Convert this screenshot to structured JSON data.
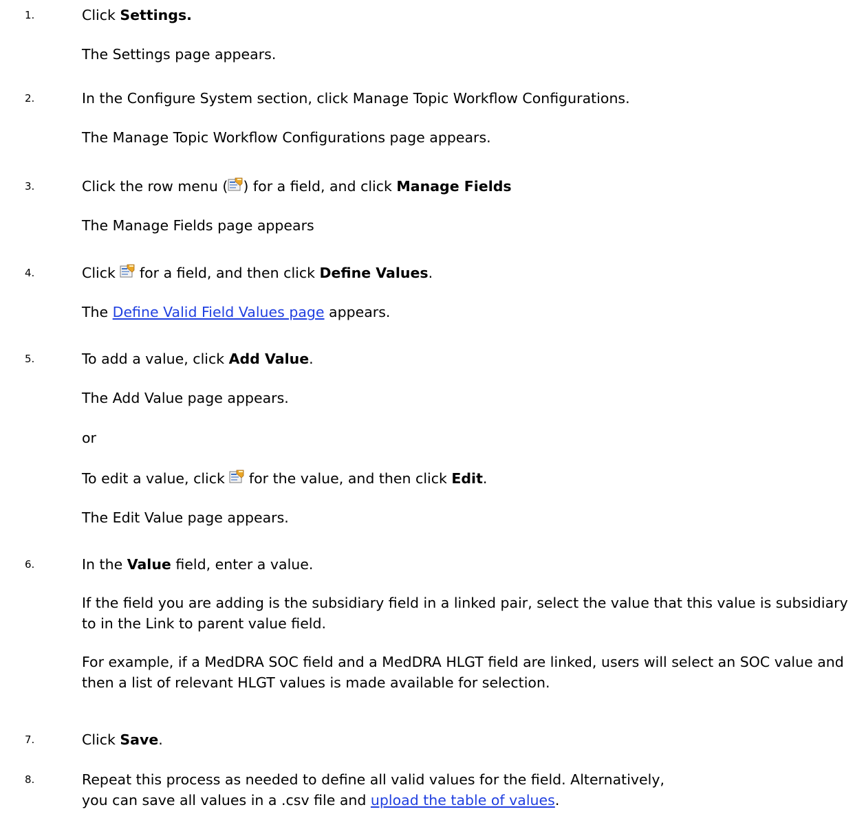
{
  "steps": {
    "s1": {
      "num": "1.",
      "pre": "Click ",
      "bold": "Settings.",
      "result": "The Settings page appears."
    },
    "s2": {
      "num": "2.",
      "text": "In the Configure System section, click Manage Topic Workflow Configurations.",
      "result": "The Manage Topic Workflow Configurations page appears."
    },
    "s3": {
      "num": "3.",
      "pre": "Click the row menu (",
      "mid": ") for a field, and click ",
      "bold": "Manage Fields",
      "result": "The Manage Fields page appears"
    },
    "s4": {
      "num": "4.",
      "pre": "Click ",
      "mid": " for a field, and then click ",
      "bold": "Define Values",
      "post": ".",
      "result_pre": "The ",
      "result_link": "Define Valid Field Values page",
      "result_post": " appears."
    },
    "s5": {
      "num": "5.",
      "pre": "To add a value, click ",
      "bold": "Add Value",
      "post": ".",
      "result": "The Add Value page appears.",
      "or": "or",
      "edit_pre": "To edit a value, click ",
      "edit_mid": " for the value, and then click ",
      "edit_bold": "Edit",
      "edit_post": ".",
      "edit_result": "The Edit Value page appears."
    },
    "s6": {
      "num": "6.",
      "pre": "In the ",
      "bold": "Value",
      "post": " field, enter a value.",
      "para1": "If the field you are adding is the subsidiary field in a linked pair, select the value that this value is subsidiary to in the Link to parent value field.",
      "para2": "For example, if a MedDRA SOC field and a MedDRA HLGT field are linked, users will select an SOC value and then a list of relevant HLGT values is made available for selection."
    },
    "s7": {
      "num": "7.",
      "pre": "Click ",
      "bold": "Save",
      "post": "."
    },
    "s8": {
      "num": "8.",
      "line1": "Repeat this process as needed to define all valid values for the field. Alternatively,",
      "line2_pre": "you can save all values in a .csv file and ",
      "line2_link": "upload the table of values",
      "line2_post": "."
    }
  },
  "icons": {
    "row_menu": "row-menu-icon"
  }
}
